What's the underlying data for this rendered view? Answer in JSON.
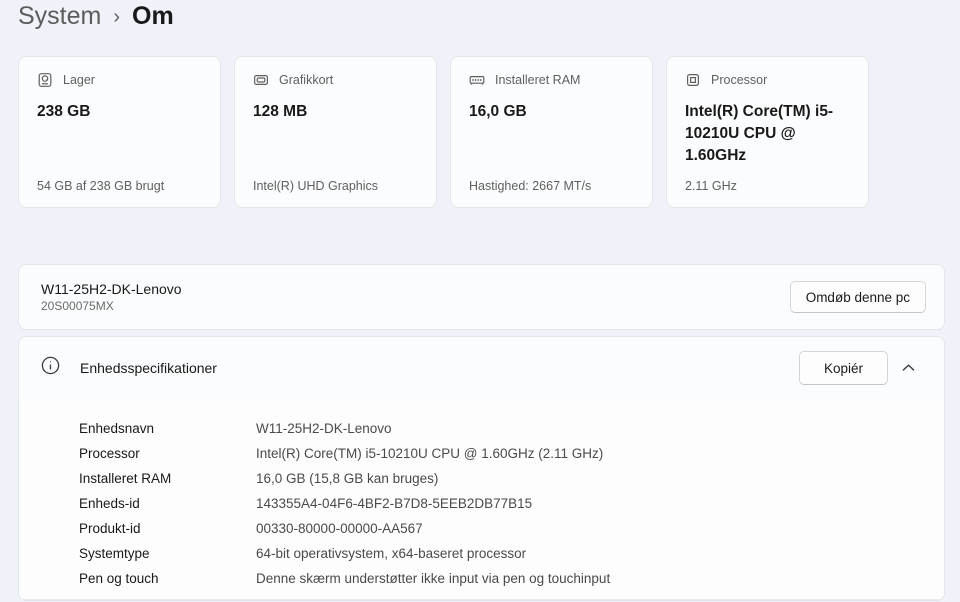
{
  "breadcrumb": {
    "parent": "System",
    "separator": "›",
    "current": "Om"
  },
  "cards": [
    {
      "icon": "storage-icon",
      "label": "Lager",
      "value": "238 GB",
      "caption": "54 GB af 238 GB brugt"
    },
    {
      "icon": "gpu-icon",
      "label": "Grafikkort",
      "value": "128 MB",
      "caption": "Intel(R) UHD Graphics"
    },
    {
      "icon": "ram-icon",
      "label": "Installeret RAM",
      "value": "16,0 GB",
      "caption": "Hastighed: 2667 MT/s"
    },
    {
      "icon": "cpu-icon",
      "label": "Processor",
      "value": "Intel(R) Core(TM) i5-10210U CPU @ 1.60GHz",
      "caption": "2.11 GHz"
    }
  ],
  "device": {
    "name": "W11-25H2-DK-Lenovo",
    "model": "20S00075MX",
    "rename_button": "Omdøb denne pc"
  },
  "specs": {
    "title": "Enhedsspecifikationer",
    "copy_button": "Kopiér",
    "rows": [
      {
        "label": "Enhedsnavn",
        "value": "W11-25H2-DK-Lenovo"
      },
      {
        "label": "Processor",
        "value": "Intel(R) Core(TM) i5-10210U CPU @ 1.60GHz (2.11 GHz)"
      },
      {
        "label": "Installeret RAM",
        "value": "16,0 GB (15,8 GB kan bruges)"
      },
      {
        "label": "Enheds-id",
        "value": "143355A4-04F6-4BF2-B7D8-5EEB2DB77B15"
      },
      {
        "label": "Produkt-id",
        "value": "00330-80000-00000-AA567"
      },
      {
        "label": "Systemtype",
        "value": "64-bit operativsystem, x64-baseret processor"
      },
      {
        "label": "Pen og touch",
        "value": "Denne skærm understøtter ikke input via pen og touchinput"
      }
    ]
  },
  "colors": {
    "page_background": "#eff3f9",
    "card_background": "#fbfcfd",
    "card_border": "#e3e6ea",
    "text_primary": "#191919",
    "text_secondary": "#5f5f5f"
  }
}
